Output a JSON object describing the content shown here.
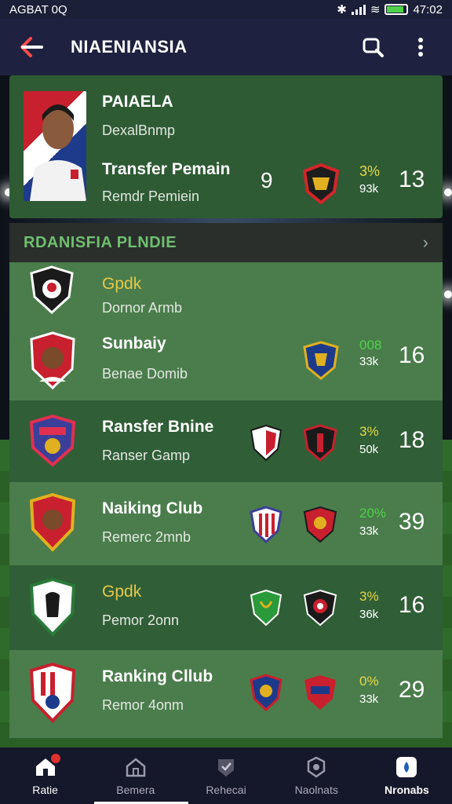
{
  "status": {
    "left": "AGBAT 0Q",
    "time": "47:02"
  },
  "appbar": {
    "title": "NIAENIANSIA"
  },
  "featured": {
    "name": "PAIAELA",
    "subtitle": "DexalBnmp",
    "line1": "Transfer Pemain",
    "line2": "Remdr Pemiein",
    "num": "9",
    "pct": "3%",
    "pct2": "93k",
    "score": "13"
  },
  "section": {
    "label": "RDANISFIA PLNDIE",
    "chevron": "›"
  },
  "rows": [
    {
      "title": "Gpdk",
      "sub": "Dornor Armb",
      "pct": "",
      "pct2": "",
      "score": ""
    },
    {
      "title": "Sunbaiy",
      "sub": "Benae Domib",
      "pct": "008",
      "pct2": "33k",
      "score": "16"
    },
    {
      "title": "Ransfer Bnine",
      "sub": "Ranser Gamp",
      "pct": "3%",
      "pct2": "50k",
      "score": "18"
    },
    {
      "title": "Naiking Club",
      "sub": "Remerc 2mnb",
      "pct": "20%",
      "pct2": "33k",
      "score": "39"
    },
    {
      "title": "Gpdk",
      "sub": "Pemor 2onn",
      "pct": "3%",
      "pct2": "36k",
      "score": "16"
    },
    {
      "title": "Ranking Cllub",
      "sub": "Remor 4onm",
      "pct": "0%",
      "pct2": "33k",
      "score": "29"
    }
  ],
  "nav": [
    {
      "label": "Ratie",
      "icon": "home-icon"
    },
    {
      "label": "Bemera",
      "icon": "building-icon"
    },
    {
      "label": "Rehecai",
      "icon": "shield-check-icon"
    },
    {
      "label": "Naolnats",
      "icon": "badge-icon"
    },
    {
      "label": "Nronabs",
      "icon": "drop-icon"
    }
  ],
  "colors": {
    "accent_green": "#4fd14a",
    "gold": "#e6d84a",
    "appbar": "#1e2240"
  }
}
